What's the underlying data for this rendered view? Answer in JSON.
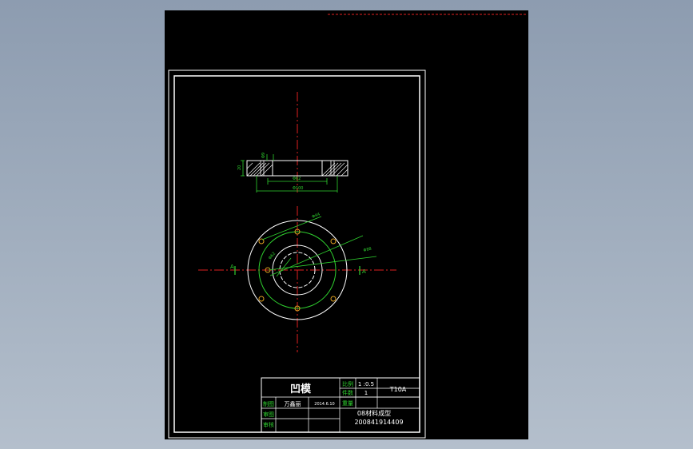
{
  "drawing": {
    "title_block": {
      "part_name": "凹模",
      "scale_label": "比例",
      "scale_value": "1 :0.5",
      "qty_label": "件数",
      "qty_value": "1",
      "weight_label": "重量",
      "material": "T10A",
      "drawn_label": "制图",
      "drawn_name": "万鑫丽",
      "drawn_date": "2014.6.10",
      "check_label": "审图",
      "review_label": "审核",
      "class_name": "08材料成型",
      "student_id": "200841914409"
    },
    "dimensions": {
      "side_height": "20",
      "inner_width": "Φ62",
      "outer_width": "Φ100",
      "bolt_dim": "Φ9",
      "pitch_dim": "Φ80",
      "outer_dia": "Φ88",
      "hole_dia": "Φ44",
      "inner_dia": "Φ62"
    },
    "section_marks": {
      "left": "A",
      "right": "A"
    }
  },
  "colors": {
    "background": "#000000",
    "geometry": "#ffffff",
    "dimension": "#2fd12f",
    "centerline": "#e02020",
    "hole": "#e0a020"
  }
}
